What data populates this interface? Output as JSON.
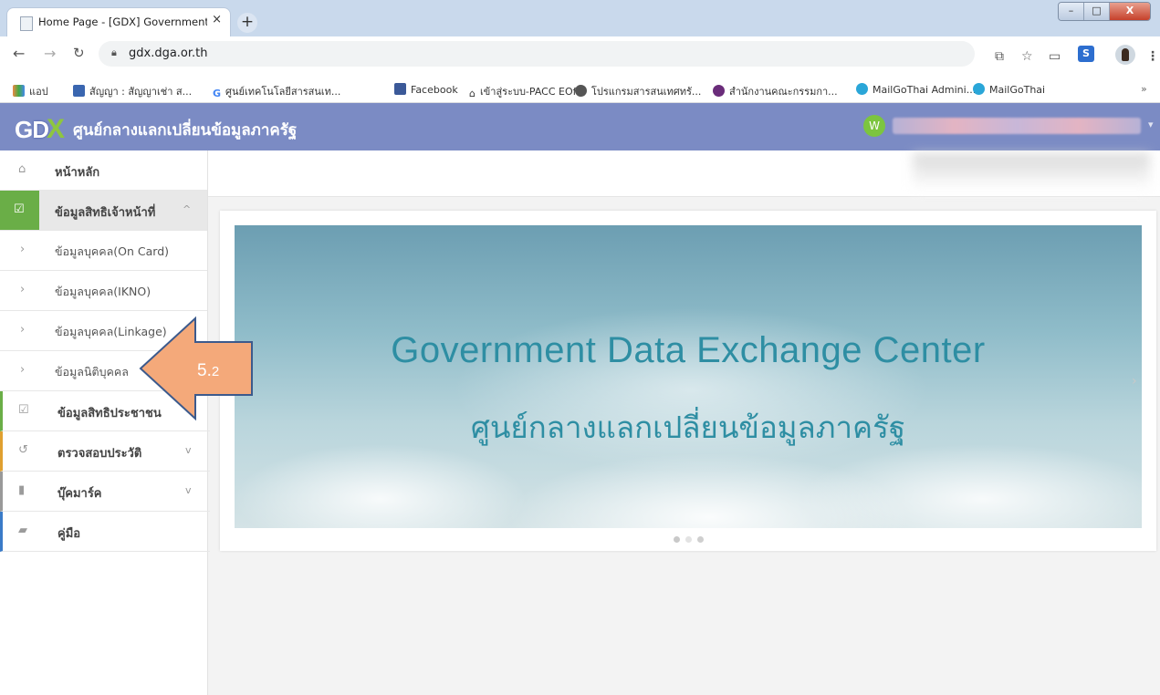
{
  "browser": {
    "tab_title": "Home Page - [GDX] Government",
    "tab_close": "×",
    "new_tab": "+",
    "url": "gdx.dga.or.th",
    "window": {
      "minimize": "–",
      "maximize": "□",
      "close": "X"
    }
  },
  "bookmarks": [
    {
      "label": "แอป",
      "icon": "apps-icon"
    },
    {
      "label": "สัญญา : สัญญาเช่า ส...",
      "icon": "sheet-icon"
    },
    {
      "label": "ศูนย์เทคโนโลยีสารสนเท...",
      "icon": "google-icon"
    },
    {
      "label": "Facebook",
      "icon": "facebook-icon"
    },
    {
      "label": "เข้าสู่ระบบ-PACC EOf...",
      "icon": "home-icon"
    },
    {
      "label": "โปรแกรมสารสนเทศทรั...",
      "icon": "globe-icon"
    },
    {
      "label": "สำนักงานคณะกรรมกา...",
      "icon": "seal-icon"
    },
    {
      "label": "MailGoThai Admini...",
      "icon": "mail-icon"
    },
    {
      "label": "MailGoThai",
      "icon": "mail-icon"
    }
  ],
  "header": {
    "logo_g": "G",
    "logo_d": "D",
    "logo_x": "X",
    "title": "ศูนย์กลางแลกเปลี่ยนข้อมูลภาครัฐ",
    "user_initial": "W"
  },
  "sidebar": {
    "items": [
      {
        "label": "หน้าหลัก",
        "icon": "home-icon"
      },
      {
        "label": "ข้อมูลสิทธิเจ้าหน้าที่",
        "icon": "check-square-icon",
        "chevron": "^"
      },
      {
        "label": "ข้อมูลบุคคล(On Card)",
        "icon": "chevron-right-icon"
      },
      {
        "label": "ข้อมูลบุคคล(IKNO)",
        "icon": "chevron-right-icon"
      },
      {
        "label": "ข้อมูลบุคคล(Linkage)",
        "icon": "chevron-right-icon"
      },
      {
        "label": "ข้อมูลนิติบุคคล",
        "icon": "chevron-right-icon"
      },
      {
        "label": "ข้อมูลสิทธิประชาชน",
        "icon": "check-square-icon"
      },
      {
        "label": "ตรวจสอบประวัติ",
        "icon": "history-icon",
        "chevron": "v"
      },
      {
        "label": "บุ๊คมาร์ค",
        "icon": "bookmark-icon",
        "chevron": "v"
      },
      {
        "label": "คู่มือ",
        "icon": "book-icon"
      }
    ]
  },
  "banner": {
    "title_en": "Government Data Exchange Center",
    "title_th": "ศูนย์กลางแลกเปลี่ยนข้อมูลภาครัฐ",
    "slides": 3,
    "active_slide": 1
  },
  "annotation": {
    "number": "5.",
    "sub": "2",
    "color": "#f4a97a"
  }
}
